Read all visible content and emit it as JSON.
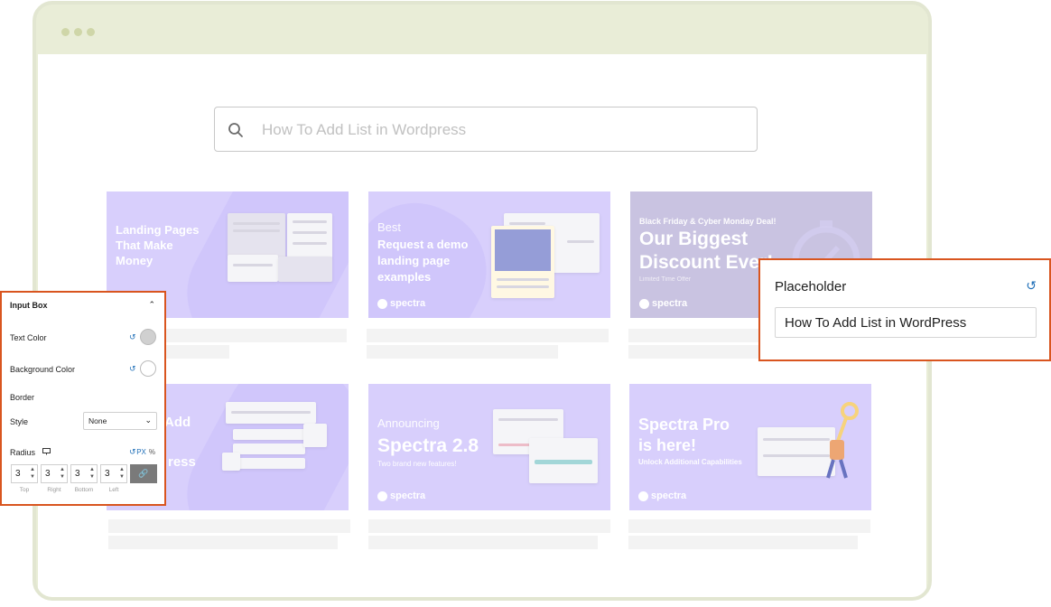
{
  "search": {
    "placeholder": "How To Add List in Wordpress"
  },
  "cards": [
    {
      "lines": [
        "Landing Pages",
        "That Make",
        "Money"
      ]
    },
    {
      "pre": "Best",
      "lines": [
        "Request a demo",
        "landing page",
        "examples"
      ],
      "brand": "spectra"
    },
    {
      "eyebrow": "Black Friday & Cyber Monday Deal!",
      "lines": [
        "Our Biggest",
        "Discount Ever!"
      ],
      "sub": "Limited Time Offer",
      "brand": "spectra"
    },
    {
      "lines": [
        "Add",
        "ress"
      ]
    },
    {
      "pre": "Announcing",
      "lines": [
        "Spectra 2.8"
      ],
      "sub": "Two brand new features!",
      "brand": "spectra"
    },
    {
      "lines": [
        "Spectra Pro",
        "is here!"
      ],
      "sub": "Unlock Additional Capabilities",
      "brand": "spectra"
    }
  ],
  "left_panel": {
    "title": "Input Box",
    "text_color_label": "Text Color",
    "bg_color_label": "Background Color",
    "border_label": "Border",
    "style_label": "Style",
    "style_value": "None",
    "radius_label": "Radius",
    "units": [
      "PX",
      "%"
    ],
    "radius_values": [
      "3",
      "3",
      "3",
      "3"
    ],
    "radius_sides": [
      "Top",
      "Right",
      "Bottom",
      "Left"
    ],
    "colors": {
      "text_swatch": "#d0d0d0",
      "bg_swatch": "#ffffff",
      "accent": "#1f6fb8",
      "highlight": "#d9551f"
    }
  },
  "right_panel": {
    "title": "Placeholder",
    "value": "How To Add List in WordPress"
  }
}
